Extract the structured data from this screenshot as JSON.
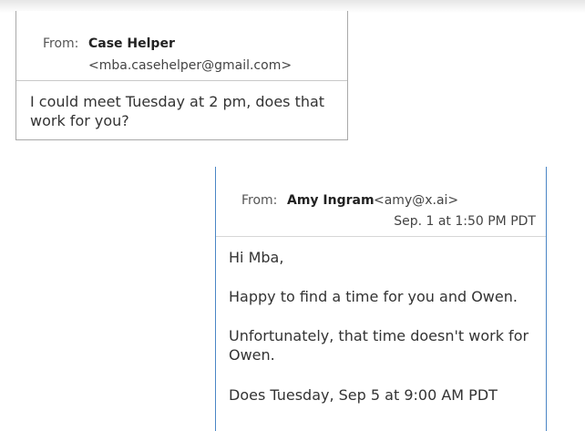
{
  "messages": [
    {
      "from_label": "From:",
      "sender_name": "Case Helper",
      "sender_address": "<mba.casehelper@gmail.com>",
      "body": "I could meet Tuesday at 2 pm, does that work for you?"
    },
    {
      "from_label": "From:",
      "sender_name": "Amy Ingram",
      "sender_address": "<amy@x.ai>",
      "timestamp": "Sep. 1 at 1:50 PM PDT",
      "paragraphs": [
        "Hi Mba,",
        "Happy to find a time for you and Owen.",
        "Unfortunately, that time doesn't work for Owen.",
        "Does Tuesday, Sep 5 at 9:00 AM PDT"
      ]
    }
  ]
}
